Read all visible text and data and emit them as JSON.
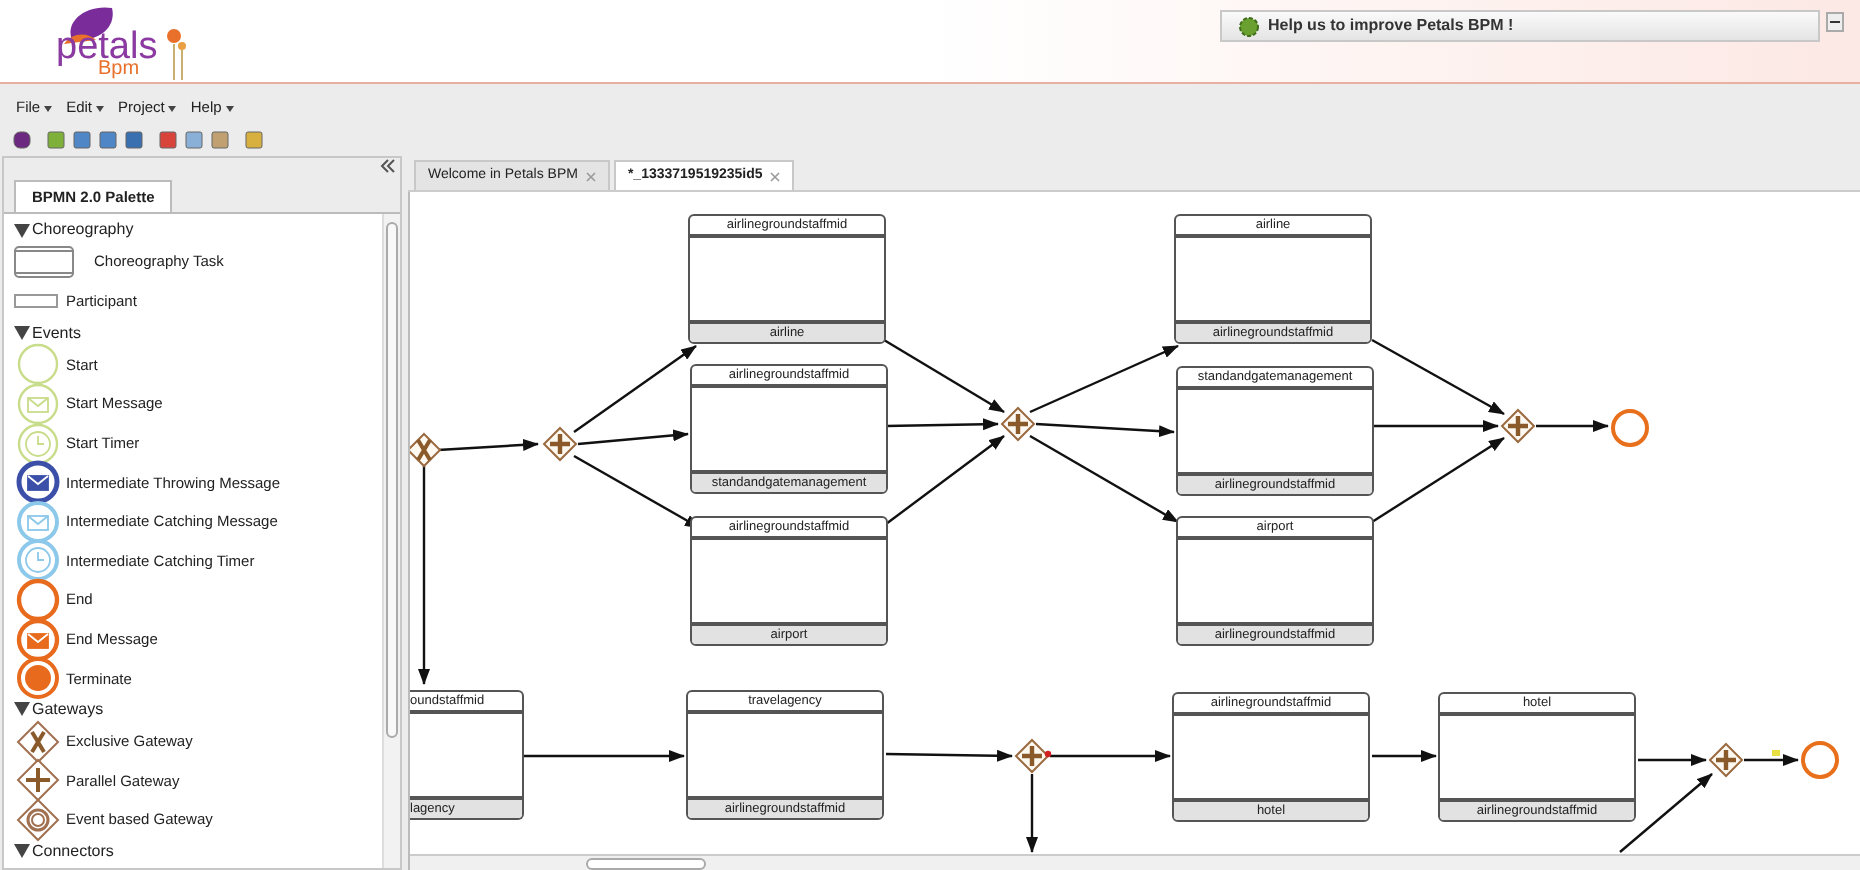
{
  "logo": {
    "name": "petals",
    "sub": "Bpm"
  },
  "help_banner": {
    "text": "Help us to improve Petals BPM !"
  },
  "menu": [
    {
      "label": "File"
    },
    {
      "label": "Edit"
    },
    {
      "label": "Project"
    },
    {
      "label": "Help"
    }
  ],
  "palette": {
    "tab": "BPMN 2.0 Palette",
    "sections": [
      {
        "label": "Choreography",
        "expanded": true,
        "items": [
          {
            "label": "Choreography Task",
            "kind": "choreography-task"
          },
          {
            "label": "Participant",
            "kind": "participant"
          }
        ]
      },
      {
        "label": "Events",
        "expanded": true,
        "items": [
          {
            "label": "Start",
            "kind": "start"
          },
          {
            "label": "Start Message",
            "kind": "start-message"
          },
          {
            "label": "Start Timer",
            "kind": "start-timer"
          },
          {
            "label": "Intermediate Throwing Message",
            "kind": "throwing-message"
          },
          {
            "label": "Intermediate Catching Message",
            "kind": "catching-message"
          },
          {
            "label": "Intermediate Catching Timer",
            "kind": "catching-timer"
          },
          {
            "label": "End",
            "kind": "end"
          },
          {
            "label": "End Message",
            "kind": "end-message"
          },
          {
            "label": "Terminate",
            "kind": "terminate"
          }
        ]
      },
      {
        "label": "Gateways",
        "expanded": true,
        "items": [
          {
            "label": "Exclusive Gateway",
            "kind": "exclusive-gateway"
          },
          {
            "label": "Parallel Gateway",
            "kind": "parallel-gateway"
          },
          {
            "label": "Event based Gateway",
            "kind": "event-gateway"
          }
        ]
      },
      {
        "label": "Connectors",
        "expanded": true
      }
    ]
  },
  "editor_tabs": [
    {
      "label": "Welcome in Petals BPM",
      "selected": false
    },
    {
      "label": "*_1333719519235id5",
      "selected": true
    }
  ],
  "diagram": {
    "tasks": [
      {
        "top": "airlinegroundstaffmid",
        "bottom": "airline",
        "clipped": false
      },
      {
        "top": "airlinegroundstaffmid",
        "bottom": "standandgatemanagement",
        "clipped": false
      },
      {
        "top": "airlinegroundstaffmid",
        "bottom": "airport",
        "clipped": false
      },
      {
        "top": "airline",
        "bottom": "airlinegroundstaffmid",
        "clipped": false
      },
      {
        "top": "standandgatemanagement",
        "bottom": "airlinegroundstaffmid",
        "clipped": false
      },
      {
        "top": "airport",
        "bottom": "airlinegroundstaffmid",
        "clipped": false
      },
      {
        "top": "oundstaffmid",
        "bottom": "lagency",
        "clipped": true
      },
      {
        "top": "travelagency",
        "bottom": "airlinegroundstaffmid",
        "clipped": false
      },
      {
        "top": "airlinegroundstaffmid",
        "bottom": "hotel",
        "clipped": false
      },
      {
        "top": "hotel",
        "bottom": "airlinegroundstaffmid",
        "clipped": false
      }
    ],
    "gateways": [
      {
        "kind": "exclusive"
      },
      {
        "kind": "parallel"
      },
      {
        "kind": "parallel"
      },
      {
        "kind": "parallel"
      },
      {
        "kind": "parallel"
      },
      {
        "kind": "parallel"
      }
    ],
    "events": [
      {
        "kind": "end"
      },
      {
        "kind": "end"
      }
    ]
  }
}
